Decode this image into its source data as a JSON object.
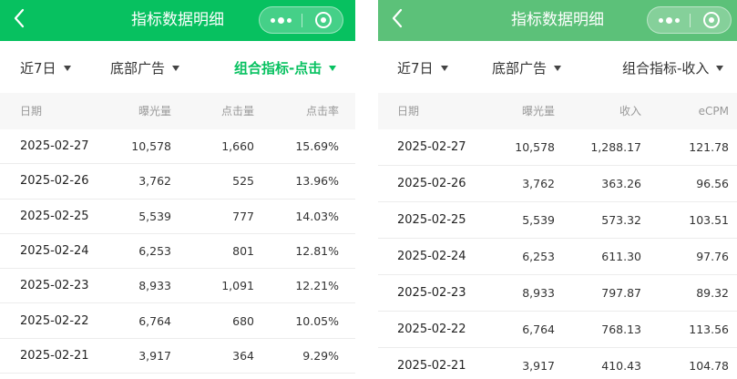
{
  "left": {
    "title": "指标数据明细",
    "filters": {
      "range": "近7日",
      "ad": "底部广告",
      "metric": "组合指标-点击"
    },
    "columns": [
      "日期",
      "曝光量",
      "点击量",
      "点击率"
    ],
    "rows": [
      [
        "2025-02-27",
        "10,578",
        "1,660",
        "15.69%"
      ],
      [
        "2025-02-26",
        "3,762",
        "525",
        "13.96%"
      ],
      [
        "2025-02-25",
        "5,539",
        "777",
        "14.03%"
      ],
      [
        "2025-02-24",
        "6,253",
        "801",
        "12.81%"
      ],
      [
        "2025-02-23",
        "8,933",
        "1,091",
        "12.21%"
      ],
      [
        "2025-02-22",
        "6,764",
        "680",
        "10.05%"
      ],
      [
        "2025-02-21",
        "3,917",
        "364",
        "9.29%"
      ]
    ]
  },
  "right": {
    "title": "指标数据明细",
    "filters": {
      "range": "近7日",
      "ad": "底部广告",
      "metric": "组合指标-收入"
    },
    "columns": [
      "日期",
      "曝光量",
      "收入",
      "eCPM"
    ],
    "rows": [
      [
        "2025-02-27",
        "10,578",
        "1,288.17",
        "121.78"
      ],
      [
        "2025-02-26",
        "3,762",
        "363.26",
        "96.56"
      ],
      [
        "2025-02-25",
        "5,539",
        "573.32",
        "103.51"
      ],
      [
        "2025-02-24",
        "6,253",
        "611.30",
        "97.76"
      ],
      [
        "2025-02-23",
        "8,933",
        "797.87",
        "89.32"
      ],
      [
        "2025-02-22",
        "6,764",
        "768.13",
        "113.56"
      ],
      [
        "2025-02-21",
        "3,917",
        "410.43",
        "104.78"
      ]
    ]
  },
  "colors": {
    "brand_green": "#07c160",
    "header_green_light": "#5cc179"
  },
  "icons": {
    "back": "chevron-left-icon",
    "more": "more-dots-icon",
    "close": "capsule-close-icon",
    "dropdown": "caret-down-icon"
  }
}
